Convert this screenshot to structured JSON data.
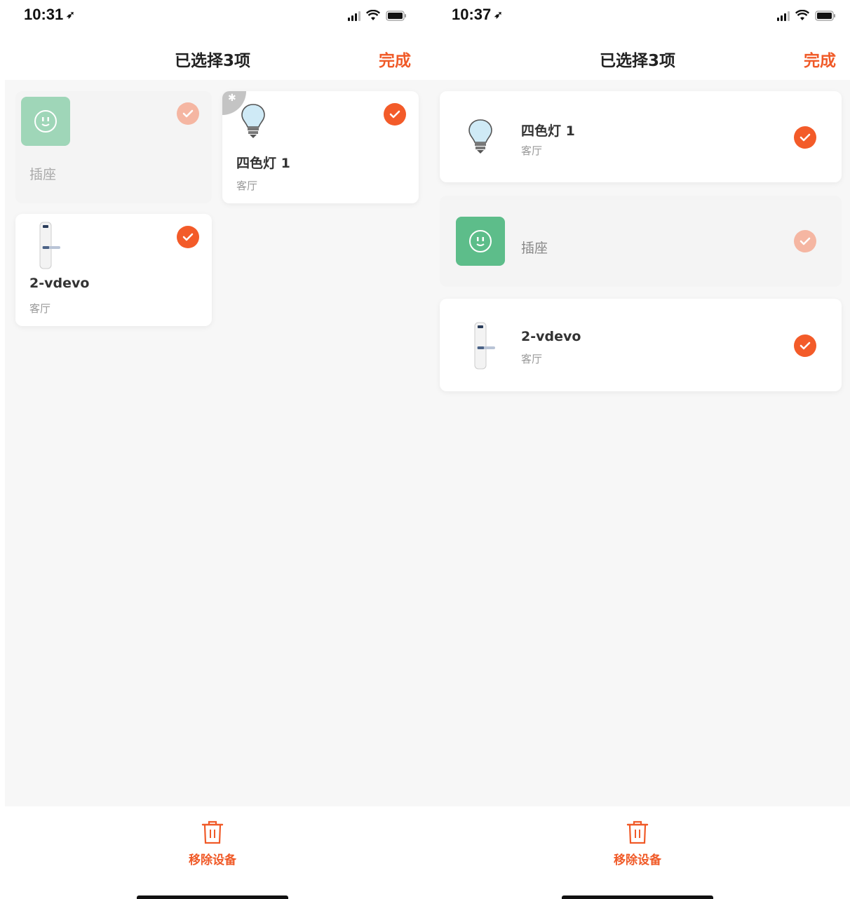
{
  "left_screen": {
    "status_bar": {
      "time": "10:31"
    },
    "nav": {
      "title": "已选择3项",
      "done": "完成"
    },
    "devices": [
      {
        "name": "插座",
        "room": "",
        "icon": "socket-icon",
        "selected": true,
        "disabled": true
      },
      {
        "name": "四色灯 1",
        "room": "客厅",
        "icon": "bulb-icon",
        "bluetooth": true,
        "selected": true,
        "disabled": false
      },
      {
        "name": "2-vdevo",
        "room": "客厅",
        "icon": "door-lock-icon",
        "selected": true,
        "disabled": false
      }
    ],
    "bottom": {
      "remove_label": "移除设备"
    }
  },
  "right_screen": {
    "status_bar": {
      "time": "10:37"
    },
    "nav": {
      "title": "已选择3项",
      "done": "完成"
    },
    "devices": [
      {
        "name": "四色灯 1",
        "room": "客厅",
        "icon": "bulb-icon",
        "selected": true,
        "disabled": false
      },
      {
        "name": "插座",
        "room": "",
        "icon": "socket-icon",
        "selected": true,
        "disabled": true
      },
      {
        "name": "2-vdevo",
        "room": "客厅",
        "icon": "door-lock-icon",
        "selected": true,
        "disabled": false
      }
    ],
    "bottom": {
      "remove_label": "移除设备"
    }
  },
  "colors": {
    "accent": "#f05a28",
    "check": "#f35b29",
    "check_faded": "#f5b6a2",
    "socket": "#5dbd8a"
  }
}
